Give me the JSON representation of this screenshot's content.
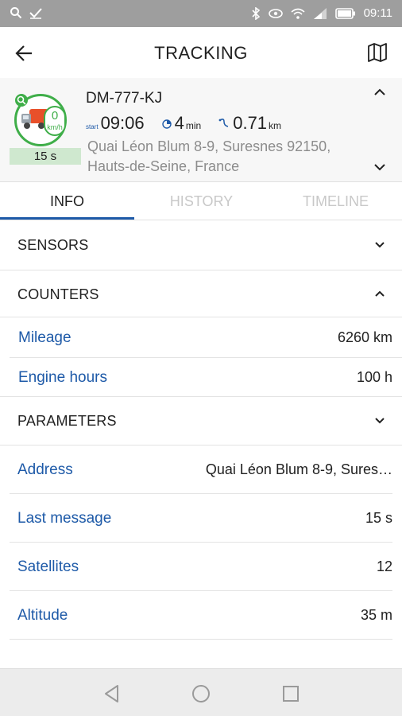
{
  "status_bar": {
    "time": "09:11",
    "icons_left": [
      "search-icon",
      "check-icon"
    ],
    "icons_right": [
      "bluetooth-icon",
      "eye-icon",
      "wifi-icon",
      "signal-icon",
      "battery-icon"
    ]
  },
  "header": {
    "title": "TRACKING",
    "back_icon": "arrow-left-icon",
    "map_icon": "map-icon"
  },
  "unit": {
    "name": "DM-777-KJ",
    "speed_value": "0",
    "speed_unit": "km/h",
    "last_update": "15 s",
    "start_label": "start",
    "start_time": "09:06",
    "duration_value": "4",
    "duration_unit": "min",
    "distance_value": "0.71",
    "distance_unit": "km",
    "address": "Quai Léon Blum 8-9, Suresnes 92150, Hauts-de-Seine, France",
    "status_color": "#3fae49"
  },
  "tabs": [
    {
      "label": "INFO",
      "active": true
    },
    {
      "label": "HISTORY",
      "active": false
    },
    {
      "label": "TIMELINE",
      "active": false
    }
  ],
  "sections": {
    "sensors": {
      "title": "SENSORS"
    },
    "counters": {
      "title": "COUNTERS",
      "rows": [
        {
          "label": "Mileage",
          "value": "6260 km"
        },
        {
          "label": "Engine hours",
          "value": "100 h"
        }
      ]
    },
    "parameters": {
      "title": "PARAMETERS",
      "rows": [
        {
          "label": "Address",
          "value": "Quai Léon Blum 8-9, Sures…"
        },
        {
          "label": "Last message",
          "value": "15 s"
        },
        {
          "label": "Satellites",
          "value": "12"
        },
        {
          "label": "Altitude",
          "value": "35 m"
        }
      ]
    }
  },
  "colors": {
    "accent": "#1e5aa8",
    "status_green": "#3fae49",
    "muted_text": "#8c8c8c"
  }
}
